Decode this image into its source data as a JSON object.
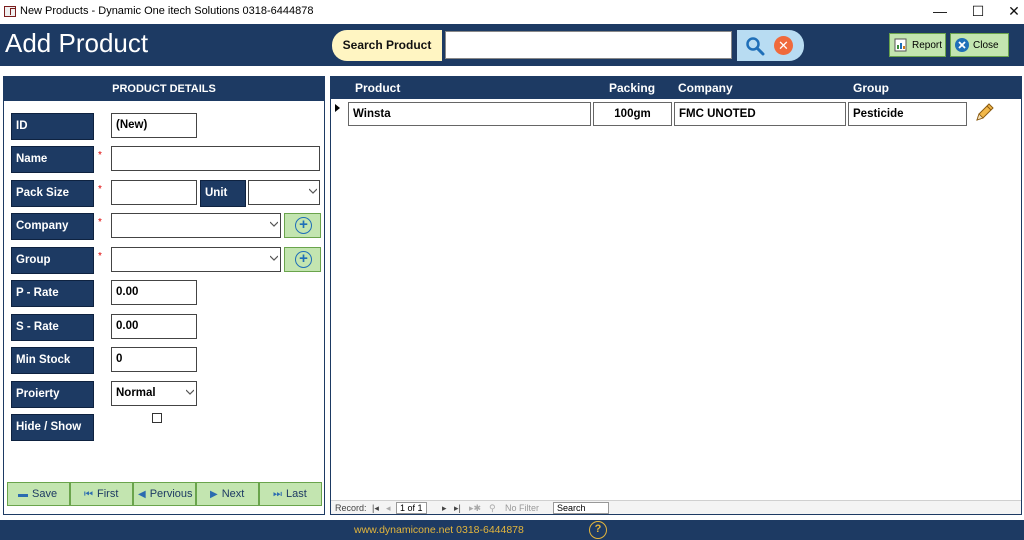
{
  "window": {
    "title": "New Products - Dynamic One itech Solutions 0318-6444878",
    "minimize_glyph": "—",
    "maximize_glyph": "☐",
    "close_glyph": "✕"
  },
  "header": {
    "title": "Add Product",
    "search_label": "Search Product",
    "search_value": "",
    "report_label": "Report",
    "close_label": "Close"
  },
  "form": {
    "panel_title": "PRODUCT DETAILS",
    "required_mark": "*",
    "fields": {
      "id": {
        "label": "ID",
        "value": "(New)"
      },
      "name": {
        "label": "Name",
        "value": ""
      },
      "pack_size": {
        "label": "Pack Size",
        "value": ""
      },
      "unit": {
        "label": "Unit",
        "value": ""
      },
      "company": {
        "label": "Company",
        "value": ""
      },
      "group": {
        "label": "Group",
        "value": ""
      },
      "p_rate": {
        "label": "P - Rate",
        "value": "0.00"
      },
      "s_rate": {
        "label": "S - Rate",
        "value": "0.00"
      },
      "min_stock": {
        "label": "Min Stock",
        "value": "0"
      },
      "priority": {
        "label": "Proierty",
        "value": "Normal"
      },
      "hide_show": {
        "label": "Hide / Show",
        "checked": false
      }
    },
    "nav": {
      "save": "Save",
      "first": "First",
      "previous": "Pervious",
      "next": "Next",
      "last": "Last"
    }
  },
  "grid": {
    "columns": [
      "Product",
      "Packing",
      "Company",
      "Group"
    ],
    "rows": [
      {
        "product": "Winsta",
        "packing": "100gm",
        "company": "FMC UNOTED",
        "group": "Pesticide"
      }
    ],
    "record_nav": {
      "label": "Record:",
      "position": "1 of 1",
      "filter": "No Filter",
      "search": "Search"
    }
  },
  "footer": {
    "text": "www.dynamicone.net 0318-6444878",
    "help_glyph": "?"
  },
  "colors": {
    "navy": "#1d3a63",
    "green_button": "#c3e5b0",
    "search_label_bg": "#fff5c2",
    "footer_text": "#e3b53c"
  }
}
